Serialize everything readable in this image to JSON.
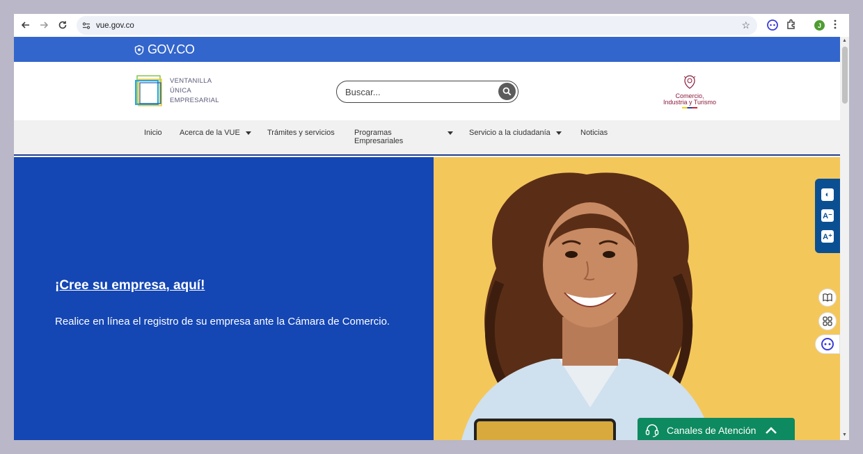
{
  "browser": {
    "url": "vue.gov.co",
    "profile_initial": "J"
  },
  "gov_bar": {
    "logo_text": "GOV.CO"
  },
  "header": {
    "vue_logo_lines": [
      "VENTANILLA",
      "ÚNICA",
      "EMPRESARIAL"
    ],
    "search_placeholder": "Buscar...",
    "ministry_line1": "Comercio,",
    "ministry_line2": "Industria y Turismo"
  },
  "nav": {
    "items": [
      {
        "label": "Inicio"
      },
      {
        "label": "Acerca de la VUE"
      },
      {
        "label": "Trámites y servicios"
      },
      {
        "label": "Programas Empresariales"
      },
      {
        "label": "Servicio a la ciudadanía"
      },
      {
        "label": "Noticias"
      }
    ]
  },
  "hero": {
    "link_text": "¡Cree su empresa, aquí!",
    "description": "Realice en línea el registro de su empresa ante la Cámara de Comercio."
  },
  "accessibility": {
    "contrast_label": "◐",
    "decrease_label": "A⁻",
    "increase_label": "A⁺"
  },
  "channels": {
    "label": "Canales de Atención"
  },
  "colors": {
    "gov_blue": "#3366cc",
    "hero_blue": "#1446b4",
    "hero_yellow": "#f4c75b",
    "green": "#0d8a5f",
    "a11y_blue": "#0b4f93"
  }
}
